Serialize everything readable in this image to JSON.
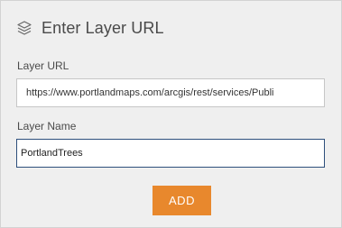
{
  "header": {
    "title": "Enter Layer URL",
    "icon": "layers-icon"
  },
  "form": {
    "url_label": "Layer URL",
    "url_value": "https://www.portlandmaps.com/arcgis/rest/services/Publi",
    "name_label": "Layer Name",
    "name_value": "PortlandTrees"
  },
  "actions": {
    "add_label": "ADD"
  },
  "colors": {
    "panel_bg": "#efefef",
    "accent_button": "#e8882d",
    "focused_border": "#2d4f7c"
  }
}
